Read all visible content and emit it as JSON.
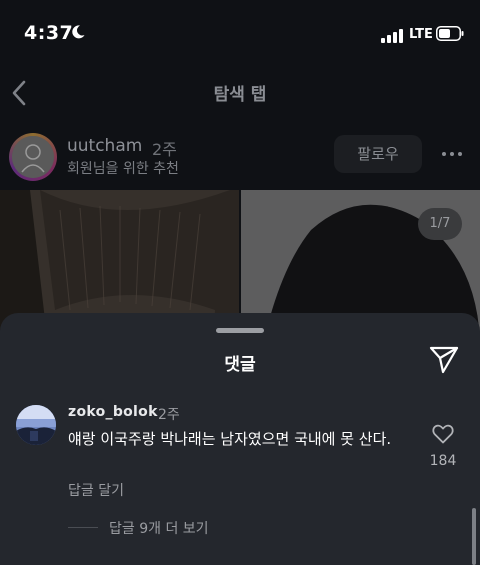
{
  "status_bar": {
    "time": "4:37",
    "network": "LTE"
  },
  "nav": {
    "title": "탐색 탭"
  },
  "post": {
    "author": "uutcham",
    "age": "2주",
    "subtitle": "회원님을 위한 추천",
    "follow_label": "팔로우",
    "image_counter": "1/7"
  },
  "comments_sheet": {
    "title": "댓글",
    "comments": [
      {
        "username": "zoko_bolok",
        "age": "2주",
        "text": "얘랑 이국주랑 박나래는 남자였으면 국내에 못 산다.",
        "reply_label": "답글 달기",
        "likes": "184",
        "view_more_replies": "답글 9개 더 보기"
      }
    ]
  }
}
